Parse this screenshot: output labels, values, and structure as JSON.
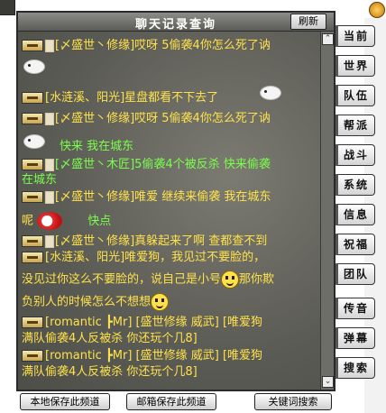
{
  "window": {
    "title": "聊天记录查询",
    "refresh_label": "刷新"
  },
  "side_tabs": [
    {
      "label": "当前"
    },
    {
      "label": "世界"
    },
    {
      "label": "队伍"
    },
    {
      "label": "帮派"
    },
    {
      "label": "战斗"
    },
    {
      "label": "系统"
    },
    {
      "label": "信息"
    },
    {
      "label": "祝福"
    },
    {
      "label": "团队"
    }
  ],
  "side_tabs_lower": [
    {
      "label": "传音"
    },
    {
      "label": "弹幕"
    },
    {
      "label": "搜索"
    }
  ],
  "bottom_buttons": {
    "local_save": "本地保存此频道",
    "mail_save": "邮箱保存此频道",
    "keyword_search": "关键词搜索"
  },
  "messages": {
    "m1": {
      "name": "[〆盛世丶修缘]",
      "text": "哎呀 5偷袭4你怎么死了讷"
    },
    "m2": {
      "name": "[水涟溪、阳光]",
      "text": "星盘都看不下去了"
    },
    "m3": {
      "name": "[〆盛世丶修缘]",
      "text": "哎呀 5偷袭4你怎么死了讷"
    },
    "m4": {
      "text": "快来 我在城东"
    },
    "m5": {
      "name": "[〆盛世丶木匠]",
      "text": "5偷袭4个被反杀 快来偷袭",
      "cont": "在城东"
    },
    "m6": {
      "name": "[〆盛世丶修缘]",
      "text": "唯爱 继续来偷袭 我在城东",
      "cont_a": "呢",
      "cont_b": "快点"
    },
    "m7": {
      "name": "[〆盛世丶修缘]",
      "text": "真躲起来了啊 查都查不到"
    },
    "m8": {
      "name": "[水涟溪、阳光]",
      "text": "唯爱狗，我见过不要脸的，",
      "cont_a": "没见过你这么不要脸的，说自己是小号",
      "cont_b": "那你欺",
      "cont_c": "负别人的时候怎么不想想"
    },
    "m9": {
      "text": "[romantic ┣Mr] [盛世修缘 威武] [唯爱狗",
      "cont": "满队偷袭4人反被杀 你还玩个几8]"
    },
    "m10": {
      "text": "[romantic ┣Mr] [盛世修缘 威武] [唯爱狗",
      "cont": "满队偷袭4人反被杀 你还玩个几8]"
    }
  }
}
